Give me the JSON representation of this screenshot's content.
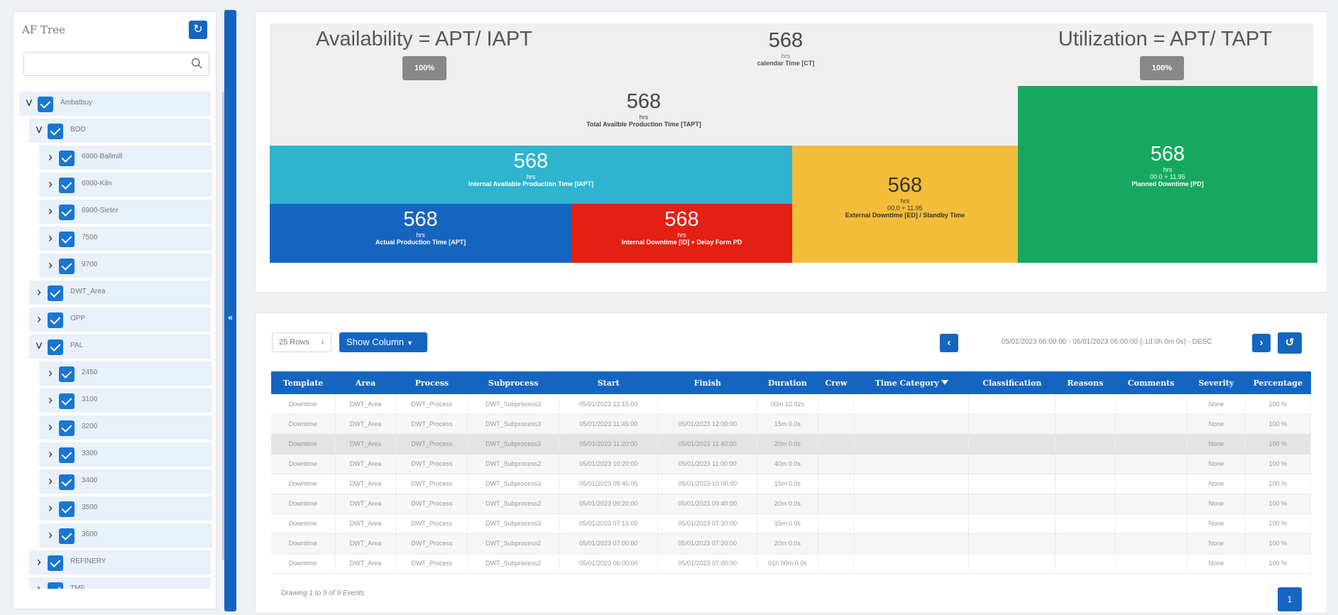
{
  "tree": {
    "title": "AF Tree",
    "search_placeholder": "",
    "items": [
      {
        "label": "Ambatbuy",
        "level": 0,
        "expanded": true
      },
      {
        "label": "BOD",
        "level": 1,
        "expanded": true
      },
      {
        "label": "6900-Ballmill",
        "level": 2,
        "expanded": false
      },
      {
        "label": "6900-Kiln",
        "level": 2,
        "expanded": false
      },
      {
        "label": "6900-Sieter",
        "level": 2,
        "expanded": false
      },
      {
        "label": "7500",
        "level": 2,
        "expanded": false
      },
      {
        "label": "9700",
        "level": 2,
        "expanded": false
      },
      {
        "label": "DWT_Area",
        "level": 1,
        "expanded": false
      },
      {
        "label": "OPP",
        "level": 1,
        "expanded": false
      },
      {
        "label": "PAL",
        "level": 1,
        "expanded": true
      },
      {
        "label": "2450",
        "level": 2,
        "expanded": false
      },
      {
        "label": "3100",
        "level": 2,
        "expanded": false
      },
      {
        "label": "3200",
        "level": 2,
        "expanded": false
      },
      {
        "label": "3300",
        "level": 2,
        "expanded": false
      },
      {
        "label": "3400",
        "level": 2,
        "expanded": false
      },
      {
        "label": "3500",
        "level": 2,
        "expanded": false
      },
      {
        "label": "3600",
        "level": 2,
        "expanded": false
      },
      {
        "label": "REFINERY",
        "level": 1,
        "expanded": false
      },
      {
        "label": "TMF",
        "level": 1,
        "expanded": false
      }
    ]
  },
  "icons": {
    "refresh": "refresh-icon",
    "search": "search-icon",
    "collapse": "double-chevron-left-icon",
    "prev": "chevron-left-icon",
    "next": "chevron-right-icon",
    "reset": "undo-icon",
    "filter": "filter-icon"
  },
  "kpi": {
    "availability_title": "Availability = APT/ IAPT",
    "availability_pct": "100%",
    "utilization_title": "Utilization = APT/ TAPT",
    "utilization_pct": "100%",
    "ct": {
      "value": "568",
      "unit": "hrs",
      "label": "calendar Time [CT]"
    },
    "tapt": {
      "value": "568",
      "unit": "hrs",
      "label": "Total Availble Production Time [TAPT]"
    },
    "iapt": {
      "value": "568",
      "unit": "hrs",
      "label": "Internal Available Production Time [IAPT]"
    },
    "apt": {
      "value": "568",
      "unit": "hrs",
      "label": "Actual Production Time [APT]"
    },
    "ido": {
      "value": "568",
      "unit": "hrs",
      "label": "Internal Downtime [ID] + Delay Form PD"
    },
    "ext": {
      "value": "568",
      "unit": "hrs",
      "sub": "00.0 + 11.95",
      "label": "External Downtime [ED] / Standby Time"
    },
    "pd": {
      "value": "568",
      "unit": "hrs",
      "sub": "00.0 + 11.95",
      "label": "Planned Downtime [PD]"
    },
    "colors": {
      "iapt": "#2eb4cf",
      "apt": "#1565c0",
      "ido": "#e41f13",
      "ext": "#f4bd39",
      "pd": "#16a85f"
    }
  },
  "table_controls": {
    "rows_label": "25 Rows",
    "show_column_label": "Show Column",
    "date_range": "05/01/2023 06:00:00 - 06/01/2023 06:00:00 (-1d 0h 0m 0s) - DESC",
    "drawing_text": "Drawing 1 to 9 of 9 Events",
    "page": "1"
  },
  "table": {
    "columns": [
      "Template",
      "Area",
      "Process",
      "Subprocess",
      "Start",
      "Finish",
      "Duration",
      "Crew",
      "Time Category",
      "Classification",
      "Reasons",
      "Comments",
      "Severity",
      "Percentage"
    ],
    "rows": [
      [
        "Downtime",
        "DWT_Area",
        "DWT_Process",
        "DWT_Subprocess3",
        "05/01/2023 12:15:00",
        "",
        "00m 12.92s",
        "",
        "",
        "",
        "",
        "",
        "None",
        "100 %"
      ],
      [
        "Downtime",
        "DWT_Area",
        "DWT_Process",
        "DWT_Subprocess3",
        "05/01/2023 11:45:00",
        "05/01/2023 12:00:00",
        "15m 0.0s",
        "",
        "",
        "",
        "",
        "",
        "None",
        "100 %"
      ],
      [
        "Downtime",
        "DWT_Area",
        "DWT_Process",
        "DWT_Subprocess3",
        "05/01/2023 11:20:00",
        "05/01/2023 11:40:00",
        "20m 0.0s",
        "",
        "",
        "",
        "",
        "",
        "None",
        "100 %"
      ],
      [
        "Downtime",
        "DWT_Area",
        "DWT_Process",
        "DWT_Subprocess2",
        "05/01/2023 10:20:00",
        "05/01/2023 11:00:00",
        "40m 0.0s",
        "",
        "",
        "",
        "",
        "",
        "None",
        "100 %"
      ],
      [
        "Downtime",
        "DWT_Area",
        "DWT_Process",
        "DWT_Subprocess3",
        "05/01/2023 09:45:00",
        "05/01/2023 10:00:00",
        "15m 0.0s",
        "",
        "",
        "",
        "",
        "",
        "None",
        "100 %"
      ],
      [
        "Downtime",
        "DWT_Area",
        "DWT_Process",
        "DWT_Subprocess2",
        "05/01/2023 09:20:00",
        "05/01/2023 09:40:00",
        "20m 0.0s",
        "",
        "",
        "",
        "",
        "",
        "None",
        "100 %"
      ],
      [
        "Downtime",
        "DWT_Area",
        "DWT_Process",
        "DWT_Subprocess3",
        "05/01/2023 07:15:00",
        "05/01/2023 07:30:00",
        "15m 0.0s",
        "",
        "",
        "",
        "",
        "",
        "None",
        "100 %"
      ],
      [
        "Downtime",
        "DWT_Area",
        "DWT_Process",
        "DWT_Subprocess2",
        "05/01/2023 07:00:00",
        "05/01/2023 07:20:00",
        "20m 0.0s",
        "",
        "",
        "",
        "",
        "",
        "None",
        "100 %"
      ],
      [
        "Downtime",
        "DWT_Area",
        "DWT_Process",
        "DWT_Subprocess2",
        "05/01/2023 06:00:00",
        "05/01/2023 07:00:00",
        "01h 00m 0.0s",
        "",
        "",
        "",
        "",
        "",
        "None",
        "100 %"
      ]
    ],
    "selected_row": 2
  }
}
